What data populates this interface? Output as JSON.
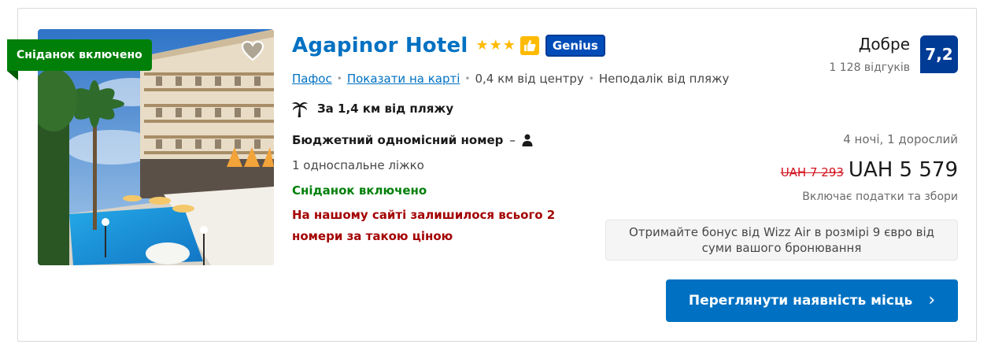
{
  "photo": {
    "badge": "Сніданок включено",
    "favorite_icon": "heart-outline-icon"
  },
  "hotel": {
    "name": "Agapinor Hotel",
    "stars": 3,
    "star_symbol": "★",
    "genius_label": "Genius"
  },
  "location": {
    "city_link": "Пафос",
    "map_link": "Показати на карті",
    "distance": "0,4 км від центру",
    "beach_note": "Неподалік від пляжу",
    "separator": "•"
  },
  "beach": {
    "icon": "palm-tree-icon",
    "text": "За 1,4 км від пляжу"
  },
  "room": {
    "name": "Бюджетний одномісний номер",
    "dash": "–",
    "person_icon": "person-icon",
    "bed": "1 односпальне ліжко",
    "breakfast": "Сніданок включено",
    "scarcity": "На нашому сайті залишилося всього 2 номери за такою ціною"
  },
  "rating": {
    "word": "Добре",
    "reviews": "1 128 відгуків",
    "score": "7,2"
  },
  "pricing": {
    "stay": "4 ночі, 1 дорослий",
    "old_price": "UAH 7 293",
    "new_price": "UAH 5 579",
    "taxes": "Включає податки та збори"
  },
  "bonus": {
    "text": "Отримайте бонус від Wizz Air в розмірі 9 євро від суми вашого бронювання"
  },
  "cta": {
    "label": "Переглянути наявність місць",
    "chevron": "›"
  },
  "colors": {
    "link": "#0071c2",
    "breakfast_green": "#008009",
    "urgent_red": "#a30000",
    "score_bg": "#003b95",
    "star_yellow": "#febb02",
    "strike_red": "#d4111e"
  }
}
